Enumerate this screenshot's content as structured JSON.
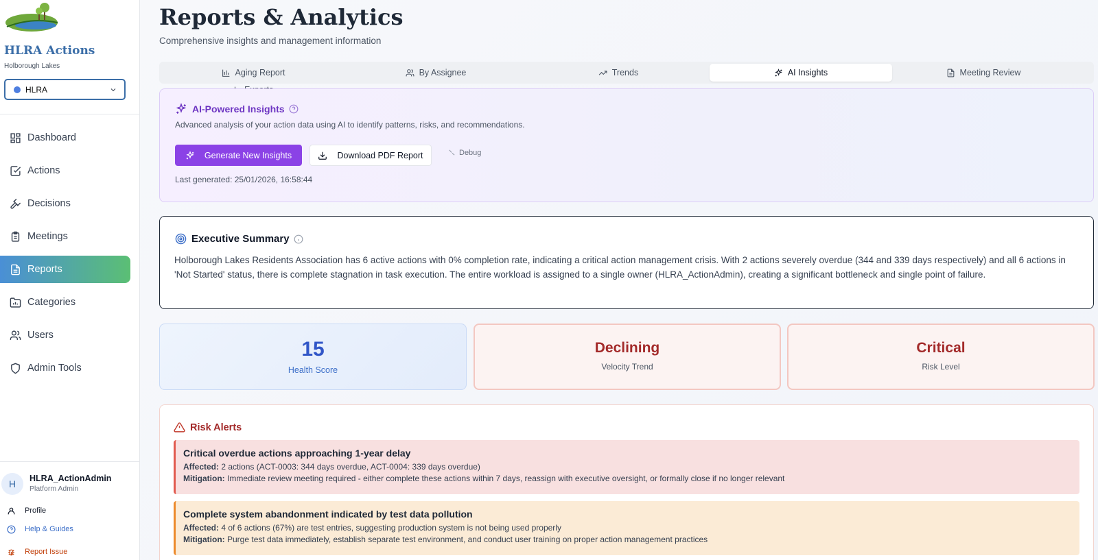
{
  "sidebar": {
    "logo_text": "Holborough Lakes",
    "brand": "HLRA Actions",
    "org_name": "Holborough Lakes",
    "org_select_value": "HLRA",
    "nav": [
      {
        "label": "Dashboard",
        "icon": "layout-dashboard-icon"
      },
      {
        "label": "Actions",
        "icon": "check-square-icon"
      },
      {
        "label": "Decisions",
        "icon": "gavel-icon"
      },
      {
        "label": "Meetings",
        "icon": "clipboard-icon"
      },
      {
        "label": "Reports",
        "icon": "file-text-icon",
        "active": true
      },
      {
        "label": "Categories",
        "icon": "folder-icon"
      },
      {
        "label": "Users",
        "icon": "users-icon"
      },
      {
        "label": "Admin Tools",
        "icon": "shield-icon"
      }
    ],
    "user": {
      "initial": "H",
      "name": "HLRA_ActionAdmin",
      "role": "Platform Admin"
    },
    "footer": {
      "profile": "Profile",
      "help": "Help & Guides",
      "report": "Report Issue"
    }
  },
  "header": {
    "title": "Reports & Analytics",
    "subtitle": "Comprehensive insights and management information"
  },
  "tabs": [
    {
      "label": "Aging Report",
      "icon": "bar-chart-icon"
    },
    {
      "label": "By Assignee",
      "icon": "users-icon"
    },
    {
      "label": "Trends",
      "icon": "trending-up-icon"
    },
    {
      "label": "AI Insights",
      "icon": "sparkles-icon",
      "active": true
    },
    {
      "label": "Meeting Review",
      "icon": "file-text-icon"
    },
    {
      "label": "Exports",
      "icon": "download-icon"
    }
  ],
  "ai_panel": {
    "title": "AI-Powered Insights",
    "description": "Advanced analysis of your action data using AI to identify patterns, risks, and recommendations.",
    "generate_label": "Generate New Insights",
    "download_label": "Download PDF Report",
    "debug_label": "Debug",
    "last_generated": "Last generated: 25/01/2026, 16:58:44"
  },
  "executive_summary": {
    "title": "Executive Summary",
    "body": "Holborough Lakes Residents Association has 6 active actions with 0% completion rate, indicating a critical action management crisis. With 2 actions severely overdue (344 and 339 days respectively) and all 6 actions in 'Not Started' status, there is complete stagnation in task execution. The entire workload is assigned to a single owner (HLRA_ActionAdmin), creating a significant bottleneck and single point of failure."
  },
  "metrics": {
    "health": {
      "value": "15",
      "label": "Health Score"
    },
    "velocity": {
      "value": "Declining",
      "label": "Velocity Trend"
    },
    "risk": {
      "value": "Critical",
      "label": "Risk Level"
    }
  },
  "risk_alerts": {
    "title": "Risk Alerts",
    "affected_label": "Affected:",
    "mitigation_label": "Mitigation:",
    "items": [
      {
        "title": "Critical overdue actions approaching 1-year delay",
        "affected": "2 actions (ACT-0003: 344 days overdue, ACT-0004: 339 days overdue)",
        "mitigation": "Immediate review meeting required - either complete these actions within 7 days, reassign with executive oversight, or formally close if no longer relevant",
        "severity_color": "#e25b4f"
      },
      {
        "title": "Complete system abandonment indicated by test data pollution",
        "affected": "4 of 6 actions (67%) are test entries, suggesting production system is not being used properly",
        "mitigation": "Purge test data immediately, establish separate test environment, and conduct user training on proper action management practices",
        "severity_color": "#ec8a2c"
      }
    ]
  },
  "colors": {
    "brand": "#3b6ea8",
    "accent_purple": "#8b42e6",
    "danger": "#a32a2a",
    "health_blue": "#3156c7"
  }
}
